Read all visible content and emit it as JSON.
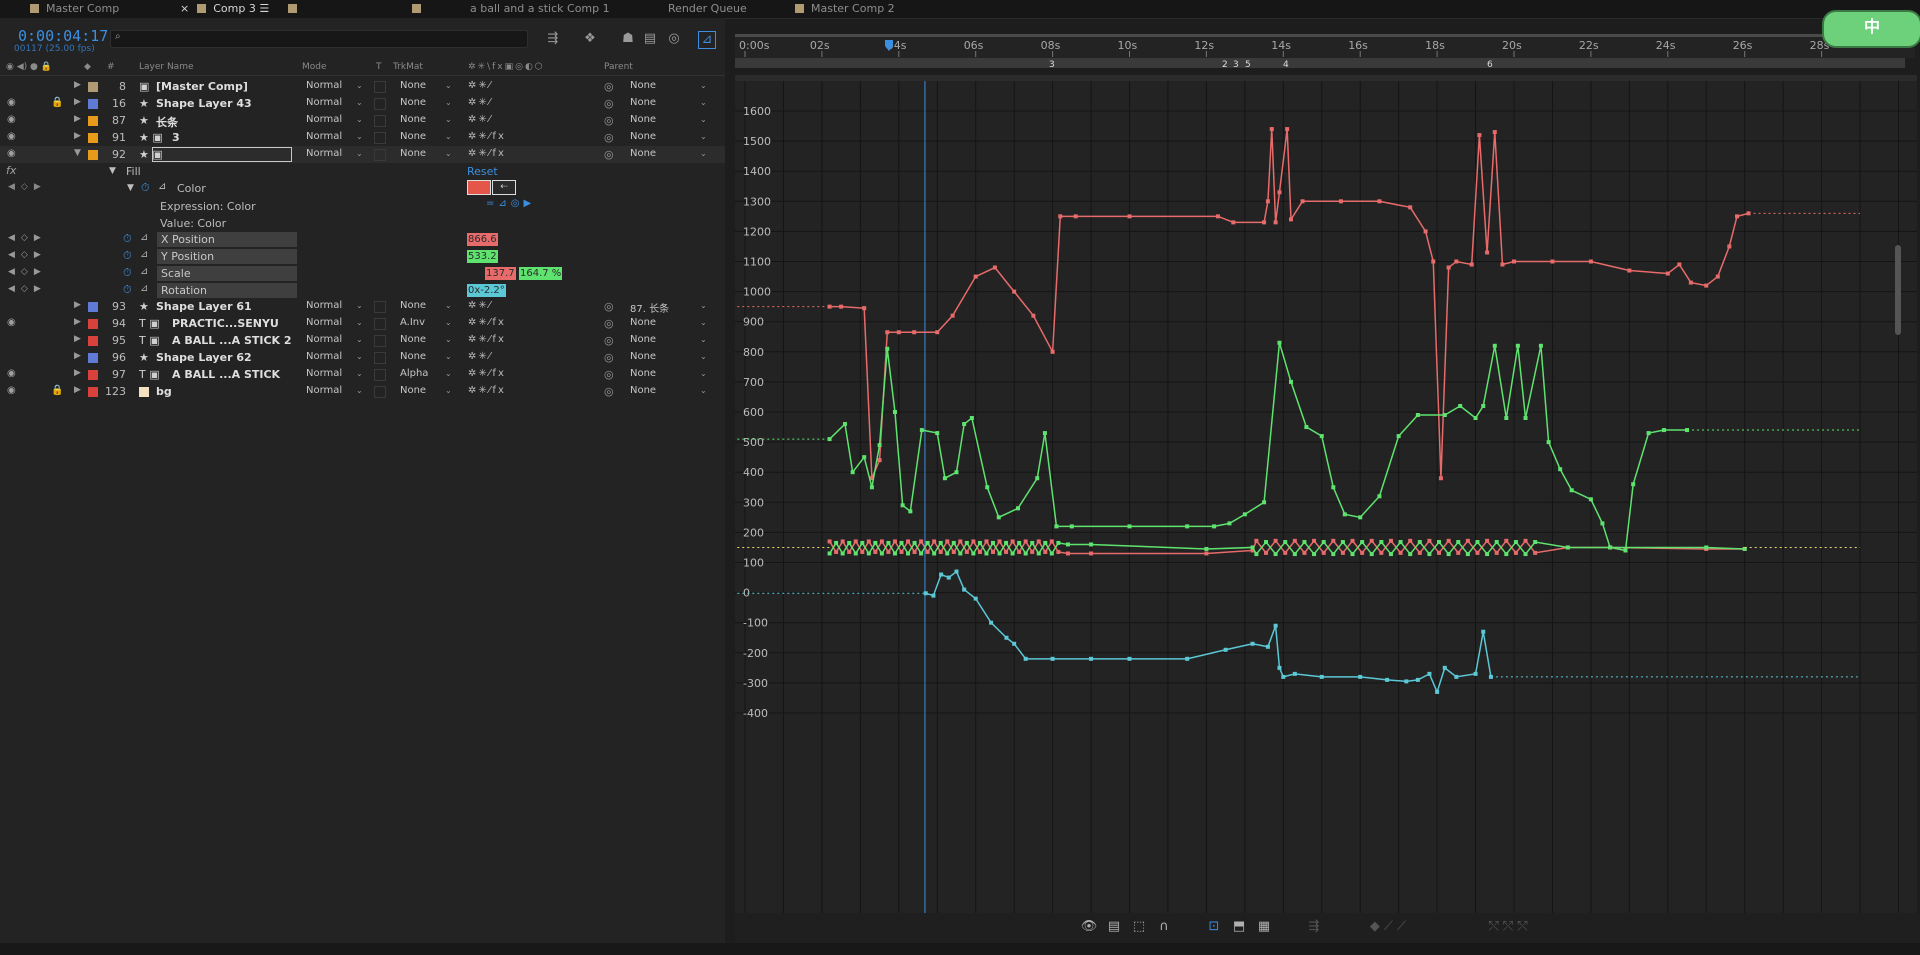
{
  "tabs": [
    {
      "label": "Master Comp",
      "active": false,
      "closable": false
    },
    {
      "label": "Comp 3",
      "active": true,
      "closable": true
    },
    {
      "label": "",
      "active": false
    },
    {
      "label": "",
      "active": false
    },
    {
      "label": "a ball and a stick Comp 1",
      "active": false
    },
    {
      "label": "Render Queue",
      "active": false
    },
    {
      "label": "Master Comp 2",
      "active": false
    }
  ],
  "timeline": {
    "timecode": "0:00:04:17",
    "fps": "00117 (25.00 fps)",
    "search_placeholder": "",
    "columns": {
      "layer_name": "Layer Name",
      "mode": "Mode",
      "t": "T",
      "trkmat": "TrkMat",
      "parent": "Parent",
      "num": "#"
    }
  },
  "layers": [
    {
      "num": "8",
      "name": "[Master Comp]",
      "type": "comp",
      "label": "#b09a72",
      "mode": "Normal",
      "trkmat": "None",
      "parent": "None",
      "visible": false,
      "locked": false,
      "fx": false
    },
    {
      "num": "16",
      "name": "Shape Layer 43",
      "type": "shape",
      "label": "#5f7bd6",
      "mode": "Normal",
      "trkmat": "None",
      "parent": "None",
      "visible": true,
      "locked": true,
      "fx": false
    },
    {
      "num": "87",
      "name": "长条",
      "type": "shape",
      "label": "#e89a1a",
      "mode": "Normal",
      "trkmat": "None",
      "parent": "None",
      "visible": true,
      "locked": false,
      "fx": false
    },
    {
      "num": "91",
      "name": "3",
      "type": "shape-comp",
      "label": "#e89a1a",
      "mode": "Normal",
      "trkmat": "None",
      "parent": "None",
      "visible": true,
      "locked": false,
      "fx": true
    },
    {
      "num": "92",
      "name": "",
      "type": "shape-comp",
      "label": "#e89a1a",
      "mode": "Normal",
      "trkmat": "None",
      "parent": "None",
      "visible": true,
      "locked": false,
      "fx": true,
      "expanded": true,
      "selected": true
    }
  ],
  "effect": {
    "fx_label": "fx",
    "group": "Fill",
    "reset": "Reset",
    "prop": "Color",
    "color_swatch": "#e5564a",
    "expression_label": "Expression: Color",
    "value_label": "Value: Color",
    "properties": [
      {
        "name": "X Position",
        "values": [
          "866.6"
        ],
        "colors": [
          "#e86b6b"
        ]
      },
      {
        "name": "Y Position",
        "values": [
          "533.2"
        ],
        "colors": [
          "#5fe36f"
        ]
      },
      {
        "name": "Scale",
        "values": [
          "137.7",
          "164.7 %"
        ],
        "colors": [
          "#e86b6b",
          "#5fe36f"
        ]
      },
      {
        "name": "Rotation",
        "values": [
          "0x-2.2°"
        ],
        "colors": [
          "#5bc8d6"
        ]
      }
    ]
  },
  "layers_after": [
    {
      "num": "93",
      "name": "Shape Layer 61",
      "type": "shape",
      "label": "#5f7bd6",
      "mode": "Normal",
      "trkmat": "None",
      "parent": "87. 长条",
      "visible": false,
      "locked": false,
      "fx": false
    },
    {
      "num": "94",
      "name": "PRACTIC...SENYU",
      "type": "text",
      "label": "#d9423c",
      "mode": "Normal",
      "trkmat": "A.Inv",
      "parent": "None",
      "visible": true,
      "locked": false,
      "fx": true
    },
    {
      "num": "95",
      "name": "A BALL ...A STICK 2",
      "type": "text",
      "label": "#d9423c",
      "mode": "Normal",
      "trkmat": "None",
      "parent": "None",
      "visible": false,
      "locked": false,
      "fx": true
    },
    {
      "num": "96",
      "name": "Shape Layer 62",
      "type": "shape",
      "label": "#5f7bd6",
      "mode": "Normal",
      "trkmat": "None",
      "parent": "None",
      "visible": false,
      "locked": false,
      "fx": false
    },
    {
      "num": "97",
      "name": "A BALL ...A STICK",
      "type": "text",
      "label": "#d9423c",
      "mode": "Normal",
      "trkmat": "Alpha",
      "parent": "None",
      "visible": true,
      "locked": false,
      "fx": true
    },
    {
      "num": "123",
      "name": "bg",
      "type": "solid",
      "label": "#d9423c",
      "mode": "Normal",
      "trkmat": "None",
      "parent": "None",
      "visible": true,
      "locked": true,
      "fx": true
    }
  ],
  "ruler": {
    "labels": [
      "0:00s",
      "02s",
      "04s",
      "06s",
      "08s",
      "10s",
      "12s",
      "14s",
      "16s",
      "18s",
      "20s",
      "22s",
      "24s",
      "26s",
      "28s"
    ],
    "markers": [
      "3",
      "2",
      "3",
      "5",
      "4",
      "6"
    ],
    "playhead_time": "04s"
  },
  "graph": {
    "y_labels": [
      "1600",
      "1500",
      "1400",
      "1300",
      "1200",
      "1100",
      "1000",
      "900",
      "800",
      "700",
      "600",
      "500",
      "400",
      "300",
      "200",
      "100",
      "0",
      "-100",
      "-200",
      "-300",
      "-400"
    ],
    "colors": {
      "red": "#e86b6b",
      "green": "#5fe36f",
      "cyan": "#5bc8d6",
      "playhead": "#3b8fe0",
      "grid": "#0f0f0f"
    }
  },
  "badge": {
    "text": "中"
  },
  "icons": {
    "shy": "shy-layers-icon",
    "cache": "frame-blending-icon",
    "motion_blur": "motion-blur-icon",
    "graph": "graph-editor-icon"
  }
}
